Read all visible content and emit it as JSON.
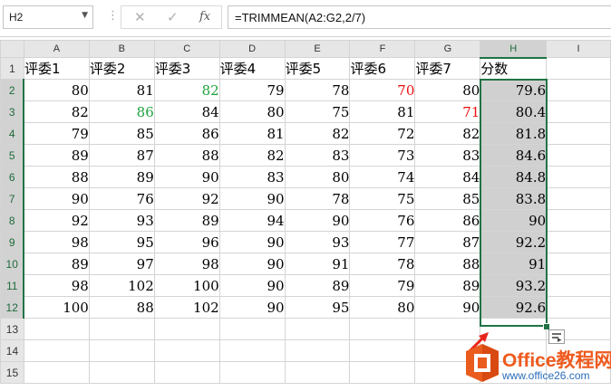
{
  "formula_bar": {
    "name_box": "H2",
    "formula": "=TRIMMEAN(A2:G2,2/7)",
    "fx_label": "fx",
    "cancel_glyph": "✕",
    "enter_glyph": "✓"
  },
  "columns": [
    "A",
    "B",
    "C",
    "D",
    "E",
    "F",
    "G",
    "H",
    "I"
  ],
  "active_column": "H",
  "rows": [
    [
      "评委1",
      "评委2",
      "评委3",
      "评委4",
      "评委5",
      "评委6",
      "评委7",
      "分数",
      ""
    ],
    [
      "80",
      "81",
      "82",
      "79",
      "78",
      "70",
      "80",
      "79.6",
      ""
    ],
    [
      "82",
      "86",
      "84",
      "80",
      "75",
      "81",
      "71",
      "80.4",
      ""
    ],
    [
      "79",
      "85",
      "86",
      "81",
      "82",
      "72",
      "82",
      "81.8",
      ""
    ],
    [
      "89",
      "87",
      "88",
      "82",
      "83",
      "73",
      "83",
      "84.6",
      ""
    ],
    [
      "88",
      "89",
      "90",
      "83",
      "80",
      "74",
      "84",
      "84.8",
      ""
    ],
    [
      "90",
      "76",
      "92",
      "90",
      "78",
      "75",
      "85",
      "83.8",
      ""
    ],
    [
      "92",
      "93",
      "89",
      "94",
      "90",
      "76",
      "86",
      "90",
      ""
    ],
    [
      "98",
      "95",
      "96",
      "90",
      "93",
      "77",
      "87",
      "92.2",
      ""
    ],
    [
      "89",
      "97",
      "98",
      "90",
      "91",
      "78",
      "88",
      "91",
      ""
    ],
    [
      "98",
      "102",
      "100",
      "90",
      "89",
      "79",
      "89",
      "93.2",
      ""
    ],
    [
      "100",
      "88",
      "102",
      "90",
      "95",
      "80",
      "90",
      "92.6",
      ""
    ],
    [
      "",
      "",
      "",
      "",
      "",
      "",
      "",
      "",
      ""
    ],
    [
      "",
      "",
      "",
      "",
      "",
      "",
      "",
      "",
      ""
    ],
    [
      "",
      "",
      "",
      "",
      "",
      "",
      "",
      "",
      ""
    ]
  ],
  "highlighted_cells": {
    "red": [
      "F2",
      "G3"
    ],
    "green": [
      "C2",
      "B3"
    ]
  },
  "colors": {
    "red": "#ee1010",
    "green": "#1fa33a",
    "selection_border": "#217346",
    "selection_fill": "#d0d0d0",
    "header_fill": "#e6e6e6"
  },
  "selection": {
    "range": "H2:H12",
    "active_cell": "H2"
  },
  "quick_analysis_icon": "quick-analysis-icon",
  "watermark": {
    "brand": "Office教程网",
    "url": "www.office26.com"
  }
}
